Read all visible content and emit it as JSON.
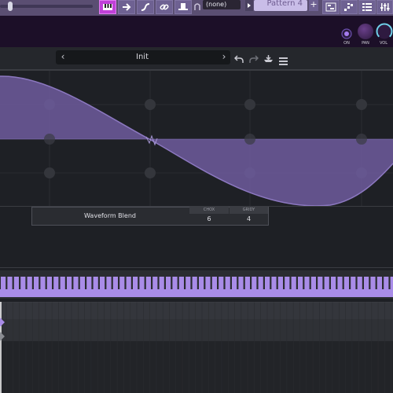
{
  "toolbar": {
    "volume_level": 0.08,
    "buttons": [
      {
        "name": "piano-roll-tool-button",
        "icon": "piano-icon",
        "active": true
      },
      {
        "name": "step-sequencer-tool-button",
        "icon": "arrow-right-icon",
        "active": false
      },
      {
        "name": "automation-tool-button",
        "icon": "curve-icon",
        "active": false
      },
      {
        "name": "link-tool-button",
        "icon": "link-icon",
        "active": false
      },
      {
        "name": "plugin-tool-button",
        "icon": "hat-icon",
        "active": false
      }
    ],
    "sample_select": "(none)",
    "pattern_label": "Pattern 4",
    "add_pattern_label": "+",
    "right_buttons": [
      {
        "name": "playlist-button",
        "icon": "playlist-icon"
      },
      {
        "name": "sequencer-button",
        "icon": "steps-icon"
      },
      {
        "name": "channel-rack-button",
        "icon": "list-icon"
      },
      {
        "name": "mixer-button",
        "icon": "mixer-icon"
      }
    ]
  },
  "channel_strip": {
    "knobs": [
      {
        "name": "on-toggle",
        "label": "ON"
      },
      {
        "name": "pan-knob",
        "label": "PAN"
      },
      {
        "name": "volume-knob",
        "label": "VOL"
      }
    ]
  },
  "preset_bar": {
    "preset_name": "Init",
    "prev_label": "‹",
    "next_label": "›",
    "icons": [
      "undo-icon",
      "redo-icon",
      "save-icon",
      "menu-icon"
    ]
  },
  "blend_panel": {
    "label": "Waveform Blend",
    "columns": [
      {
        "header": "CHOX",
        "value": "6"
      },
      {
        "header": "GRIDY",
        "value": "4"
      }
    ]
  },
  "colors": {
    "accent": "#c040d8",
    "wave_fill": "#6f5c9e",
    "wave_line": "#8c78c0",
    "key_purple": "#a98ce8"
  }
}
